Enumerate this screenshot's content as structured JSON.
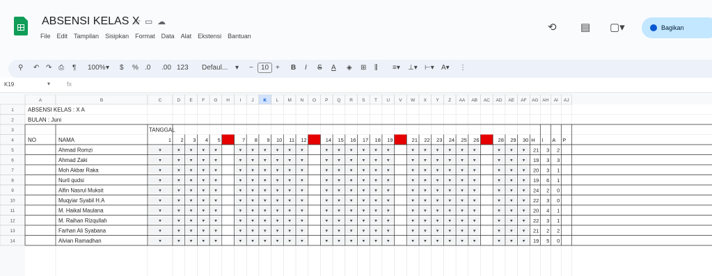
{
  "app": {
    "title": "ABSENSI KELAS X",
    "menu": [
      "File",
      "Edit",
      "Tampilan",
      "Sisipkan",
      "Format",
      "Data",
      "Alat",
      "Ekstensi",
      "Bantuan"
    ],
    "share_label": "Bagikan"
  },
  "toolbar": {
    "zoom": "100%",
    "currency": "$",
    "percent": "%",
    "decimal_dec": ".0",
    "decimal_inc": ".00",
    "number_format": "123",
    "font": "Defaul...",
    "font_size": "10"
  },
  "formula_bar": {
    "cell_ref": "K19",
    "fx": "fx"
  },
  "colors": {
    "holiday": "#e60000",
    "selected_header": "#0b57d0",
    "accent": "#c2e7ff"
  },
  "sheet": {
    "title": "ABSENSI KELAS : X A",
    "bulan": "BULAN : Juni",
    "tanggal_label": "TANGGAL",
    "no_label": "NO",
    "nama_label": "NAMA",
    "col_letters": [
      "A",
      "B",
      "C",
      "D",
      "E",
      "F",
      "G",
      "H",
      "I",
      "J",
      "K",
      "L",
      "M",
      "N",
      "O",
      "P",
      "Q",
      "R",
      "S",
      "T",
      "U",
      "V",
      "W",
      "X",
      "Y",
      "Z",
      "AA",
      "AB",
      "AC",
      "AD",
      "AE",
      "AF",
      "AG",
      "AH",
      "AI",
      "AJ"
    ],
    "dates": [
      1,
      2,
      3,
      4,
      5,
      6,
      7,
      8,
      9,
      10,
      11,
      12,
      13,
      14,
      15,
      16,
      17,
      18,
      19,
      20,
      21,
      22,
      23,
      24,
      25,
      26,
      27,
      28,
      29,
      30
    ],
    "holiday_dates": [
      6,
      13,
      20,
      27
    ],
    "summary_headers": [
      "H",
      "I",
      "A",
      "P"
    ],
    "students": [
      {
        "name": "Ahmad Romzi",
        "h": 21,
        "i": 3,
        "a": 2
      },
      {
        "name": "Ahmad Zaki",
        "h": 19,
        "i": 3,
        "a": 3
      },
      {
        "name": "Moh Akbar Raka",
        "h": 20,
        "i": 3,
        "a": 1
      },
      {
        "name": "Nuril qudsi",
        "h": 19,
        "i": 6,
        "a": 1
      },
      {
        "name": "Alfin Nasrul Muksit",
        "h": 24,
        "i": 2,
        "a": 0
      },
      {
        "name": "Muqyiar Syabil H.A",
        "h": 22,
        "i": 3,
        "a": 0
      },
      {
        "name": "M. Haikal Maulana",
        "h": 20,
        "i": 4,
        "a": 1
      },
      {
        "name": "M. Raihan Rizqullah",
        "h": 22,
        "i": 3,
        "a": 1
      },
      {
        "name": "Farhan Ali Syabana",
        "h": 21,
        "i": 2,
        "a": 2
      },
      {
        "name": "Alvian Ramadhan",
        "h": 19,
        "i": 5,
        "a": 0
      }
    ]
  }
}
